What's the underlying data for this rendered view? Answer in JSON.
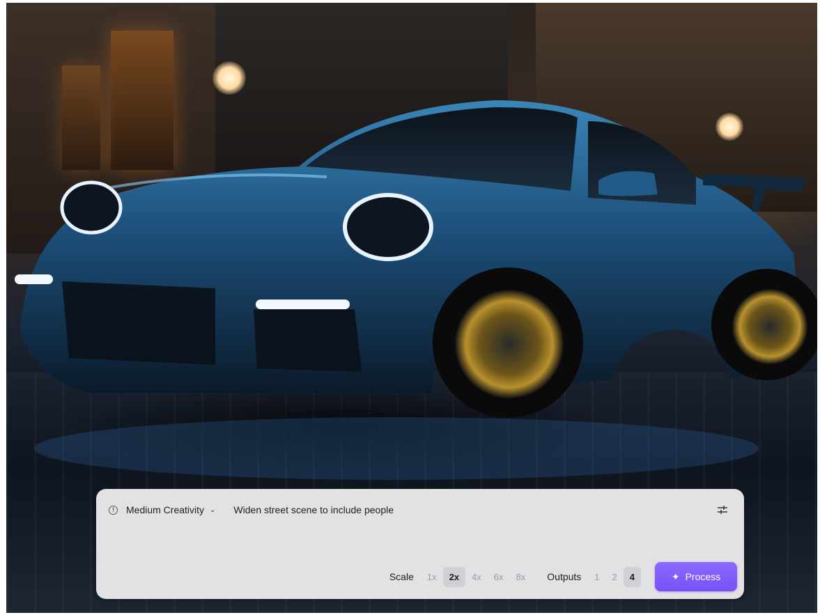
{
  "prompt_bar": {
    "creativity_label": "Medium Creativity",
    "prompt_text": "Widen street scene to include people"
  },
  "scale": {
    "label": "Scale",
    "options": [
      "1x",
      "2x",
      "4x",
      "6x",
      "8x"
    ],
    "selected": "2x"
  },
  "outputs": {
    "label": "Outputs",
    "options": [
      "1",
      "2",
      "4"
    ],
    "selected": "4"
  },
  "process_button": {
    "label": "Process"
  },
  "icons": {
    "info": "info-icon",
    "chevron": "chevron-down-icon",
    "settings": "sliders-icon",
    "sparkle": "sparkle-icon"
  },
  "colors": {
    "panel": "#e2e2e5",
    "accent": "#7a55f8",
    "car_body": "#1d4f7a"
  }
}
